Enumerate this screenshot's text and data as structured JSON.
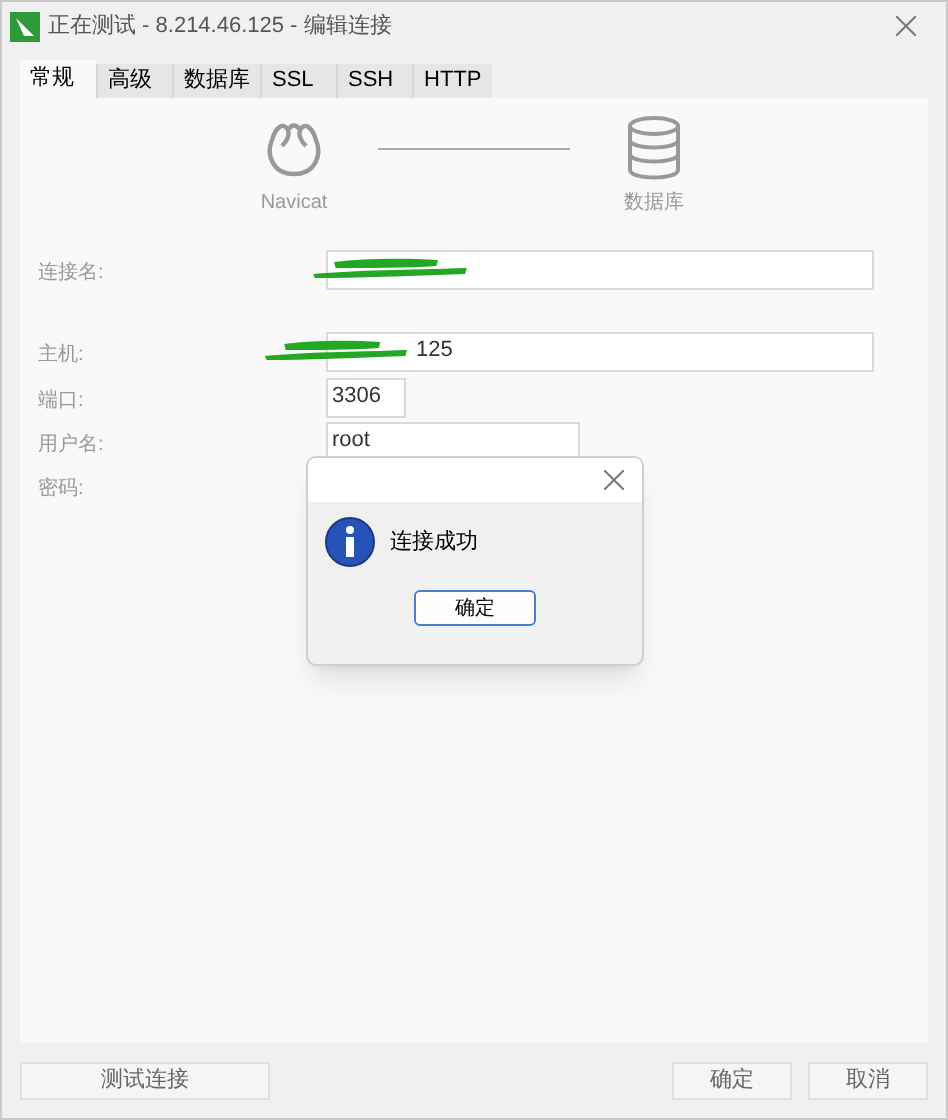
{
  "window": {
    "title": "正在测试 - 8.214.46.125 - 编辑连接"
  },
  "tabs": [
    {
      "label": "常规",
      "selected": true
    },
    {
      "label": "高级",
      "selected": false
    },
    {
      "label": "数据库",
      "selected": false
    },
    {
      "label": "SSL",
      "selected": false
    },
    {
      "label": "SSH",
      "selected": false
    },
    {
      "label": "HTTP",
      "selected": false
    }
  ],
  "diagram": {
    "left_label": "Navicat",
    "right_label": "数据库"
  },
  "fields": [
    {
      "label": "连接名:",
      "kind": "input"
    },
    {
      "label": "主机:",
      "value": "125",
      "kind": "input"
    },
    {
      "label": "端口:",
      "value": "3306",
      "kind": "input"
    },
    {
      "label": "用户名:",
      "value": "root",
      "kind": "input"
    },
    {
      "label": "密码:",
      "kind": "label"
    }
  ],
  "dialog": {
    "message": "连接成功",
    "button": "确定"
  },
  "footer": {
    "test_button": "测试连接",
    "ok_button": "确定",
    "cancel_button": "取消"
  }
}
